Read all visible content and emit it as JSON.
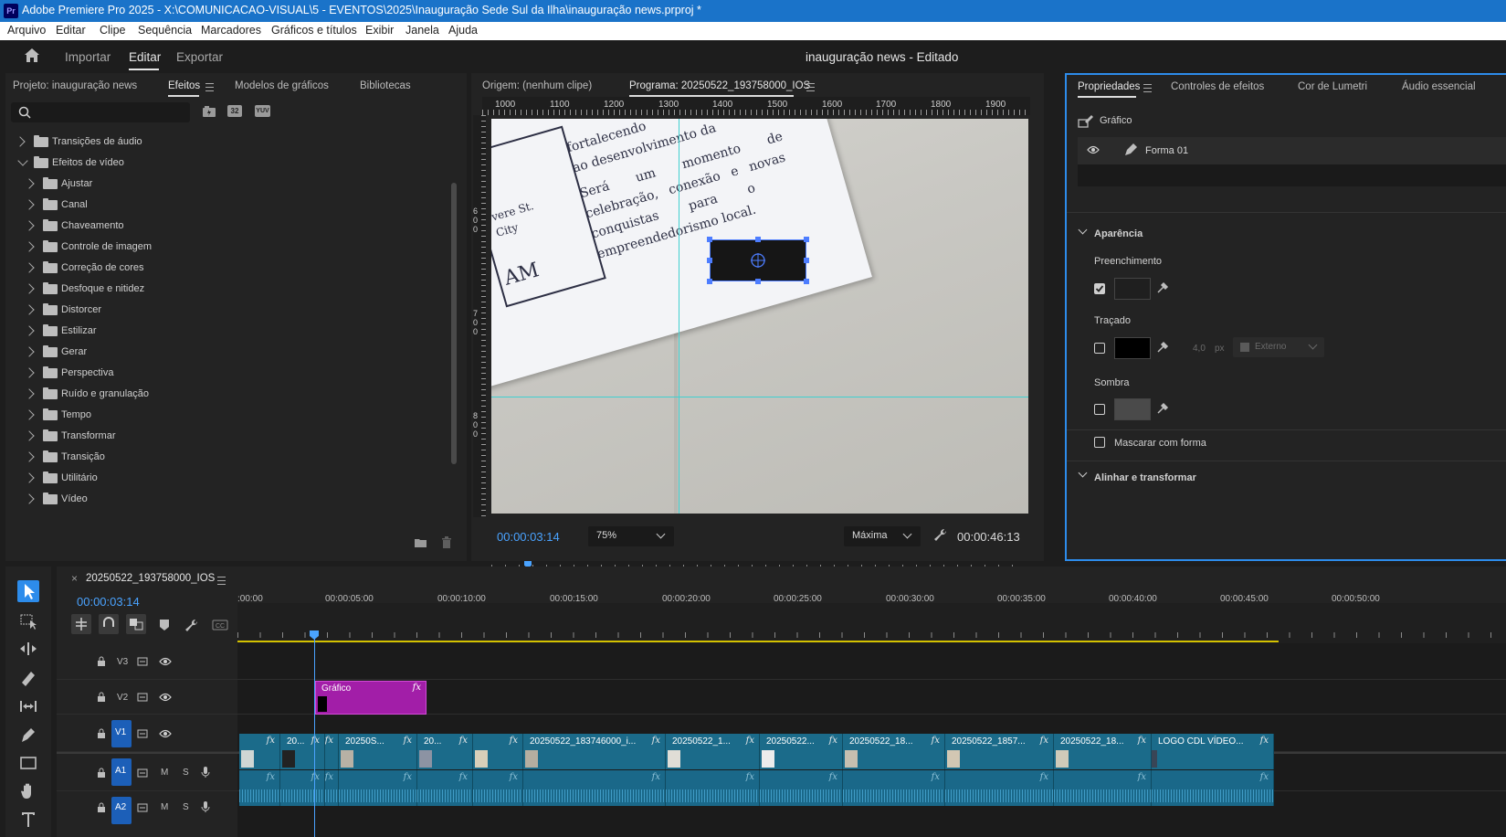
{
  "app": {
    "title": "Adobe Premiere Pro 2025 - X:\\COMUNICACAO-VISUAL\\5 - EVENTOS\\2025\\Inauguração Sede Sul da Ilha\\inauguração news.prproj *",
    "logo": "Pr"
  },
  "menu": [
    "Arquivo",
    "Editar",
    "Clipe",
    "Sequência",
    "Marcadores",
    "Gráficos e títulos",
    "Exibir",
    "Janela",
    "Ajuda"
  ],
  "workspace": {
    "tabs": [
      "Importar",
      "Editar",
      "Exportar"
    ],
    "active": "Editar",
    "project_title": "inauguração news - Editado"
  },
  "left_panel": {
    "tabs": [
      "Projeto: inauguração news",
      "Efeitos",
      "Modelos de gráficos",
      "Bibliotecas"
    ],
    "search_placeholder": "",
    "badge_32": "32",
    "badge_yuv": "YUV",
    "tree": [
      {
        "label": "Transições de áudio",
        "level": 0,
        "expanded": false
      },
      {
        "label": "Efeitos de vídeo",
        "level": 0,
        "expanded": true
      },
      {
        "label": "Ajustar",
        "level": 1
      },
      {
        "label": "Canal",
        "level": 1
      },
      {
        "label": "Chaveamento",
        "level": 1
      },
      {
        "label": "Controle de imagem",
        "level": 1
      },
      {
        "label": "Correção de cores",
        "level": 1
      },
      {
        "label": "Desfoque e nitidez",
        "level": 1
      },
      {
        "label": "Distorcer",
        "level": 1
      },
      {
        "label": "Estilizar",
        "level": 1
      },
      {
        "label": "Gerar",
        "level": 1
      },
      {
        "label": "Perspectiva",
        "level": 1
      },
      {
        "label": "Ruído e granulação",
        "level": 1
      },
      {
        "label": "Tempo",
        "level": 1
      },
      {
        "label": "Transformar",
        "level": 1
      },
      {
        "label": "Transição",
        "level": 1
      },
      {
        "label": "Utilitário",
        "level": 1
      },
      {
        "label": "Vídeo",
        "level": 1
      }
    ]
  },
  "monitor": {
    "tabs": [
      "Origem: (nenhum clipe)",
      "Programa: 20250522_193758000_IOS"
    ],
    "ruler_labels": [
      "1000",
      "1100",
      "1200",
      "1300",
      "1400",
      "1500",
      "1600",
      "1700",
      "1800",
      "1900"
    ],
    "vruler_labels": [
      "500",
      "600",
      "700",
      "800",
      "900",
      "1000"
    ],
    "playhead_time": "00:00:03:14",
    "zoom": "75%",
    "quality": "Máxima",
    "duration": "00:00:46:13",
    "playhead_fraction": 0.071,
    "paper_text": {
      "l1": "fortalecendo",
      "l2": "ao desenvolvimento da",
      "l3": "Será um momento de",
      "l4": "celebração, conexão e novas",
      "l5": "conquistas para o",
      "l6": "empreendedorismo local.",
      "side1": "vere St.",
      "side2": "City",
      "am": "AM"
    }
  },
  "properties": {
    "tabs": [
      "Propriedades",
      "Controles de efeitos",
      "Cor de Lumetri",
      "Áudio essencial"
    ],
    "graphic_label": "Gráfico",
    "layer_name": "Forma 01",
    "appearance": "Aparência",
    "fill_label": "Preenchimento",
    "fill_checked": true,
    "fill_color": "#1f1f1f",
    "stroke_label": "Traçado",
    "stroke_checked": false,
    "stroke_color": "#000000",
    "stroke_width": "4,0",
    "stroke_unit": "px",
    "stroke_type": "Externo",
    "shadow_label": "Sombra",
    "shadow_checked": false,
    "shadow_color": "#4a4a4a",
    "mask_label": "Mascarar com forma",
    "align_label": "Alinhar e transformar"
  },
  "timeline": {
    "sequence_name": "20250522_193758000_IOS",
    "timecode": "00:00:03:14",
    "ruler": [
      ":00:00",
      "00:00:05:00",
      "00:00:10:00",
      "00:00:15:00",
      "00:00:20:00",
      "00:00:25:00",
      "00:00:30:00",
      "00:00:35:00",
      "00:00:40:00",
      "00:00:45:00",
      "00:00:50:00"
    ],
    "tracks": [
      "V3",
      "V2",
      "V1",
      "A1",
      "A2"
    ],
    "track_m": "M",
    "track_s": "S",
    "graphic_clip": "Gráfico",
    "fx": "fx",
    "v1_clips": [
      "",
      "20...",
      "",
      "20250S...",
      "20...",
      "",
      "20250522_183746000_i...",
      "20250522_1...",
      "20250522...",
      "20250522_18...",
      "20250522_1857...",
      "20250522_18...",
      "LOGO CDL VÍDEO..."
    ]
  },
  "colors": {
    "accent": "#2d8ceb",
    "timecode": "#4aa3ff",
    "title_bar": "#1a73c9",
    "clip_video": "#1b6b8a",
    "clip_graphic": "#a21ea8",
    "guide": "#40d0d0"
  }
}
